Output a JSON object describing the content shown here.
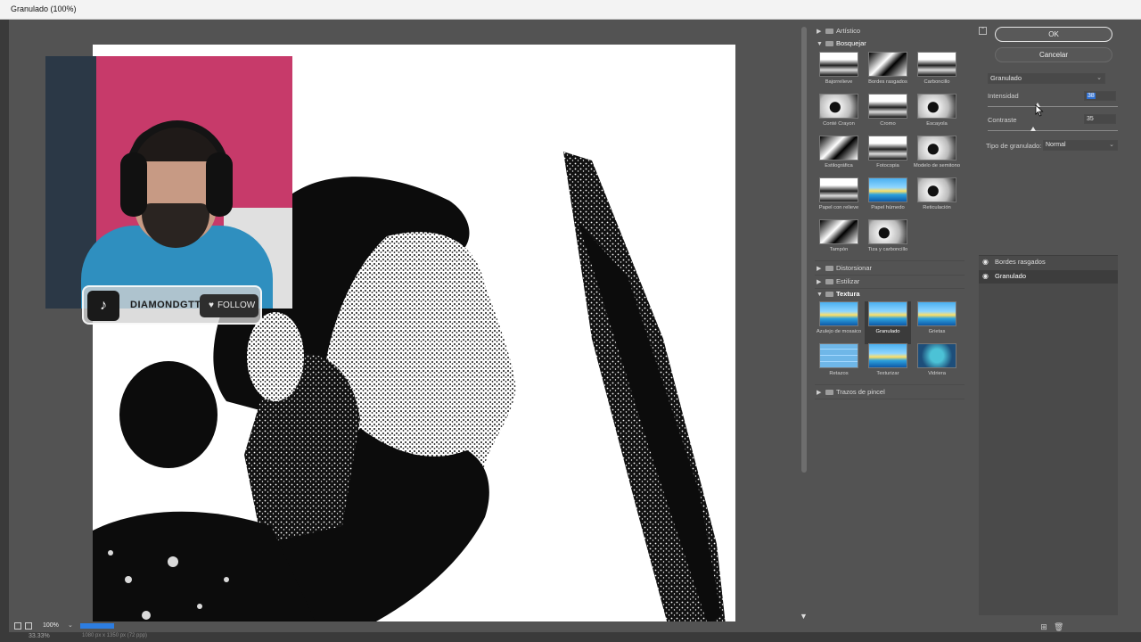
{
  "window": {
    "title": "Granulado (100%)"
  },
  "preview": {
    "zoom": "100%",
    "status_zoom": "33.33%",
    "doc_info": "1080 px x 1350 px (72 ppp)"
  },
  "stream_overlay": {
    "channel_name": "DIAMONDGTTV",
    "follow_label": "FOLLOW"
  },
  "gallery": {
    "categories": [
      {
        "label": "Artístico",
        "expanded": false
      },
      {
        "label": "Bosquejar",
        "expanded": true,
        "filters": [
          "Bajorrelieve",
          "Bordes rasgados",
          "Carboncillo",
          "Conté Crayon",
          "Cromo",
          "Escayola",
          "Estilográfica",
          "Fotocopia",
          "Modelo de semitono",
          "Papel con relieve",
          "Papel húmedo",
          "Reticulación",
          "Tampón",
          "Tiza y carboncillo"
        ]
      },
      {
        "label": "Distorsionar",
        "expanded": false
      },
      {
        "label": "Estilizar",
        "expanded": false
      },
      {
        "label": "Textura",
        "expanded": true,
        "filters": [
          "Azulejo de mosaico",
          "Granulado",
          "Grietas",
          "Retazos",
          "Texturizar",
          "Vidriera"
        ]
      },
      {
        "label": "Trazos de pincel",
        "expanded": false
      }
    ],
    "selected_filter": "Granulado"
  },
  "settings": {
    "ok_label": "OK",
    "cancel_label": "Cancelar",
    "filter_select": "Granulado",
    "intensity": {
      "label": "Intensidad",
      "value": "38"
    },
    "contrast": {
      "label": "Contraste",
      "value": "35"
    },
    "grain_type": {
      "label": "Tipo de granulado:",
      "value": "Normal"
    }
  },
  "layers": [
    {
      "name": "Bordes rasgados",
      "visible": true,
      "active": false
    },
    {
      "name": "Granulado",
      "visible": true,
      "active": true
    }
  ]
}
